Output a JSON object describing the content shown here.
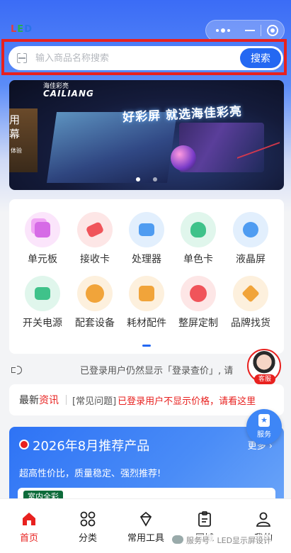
{
  "header": {
    "logo": [
      "L",
      "E",
      "D"
    ]
  },
  "search": {
    "placeholder": "输入商品名称搜索",
    "button_label": "搜索"
  },
  "banner": {
    "brand_cn": "海佳彩亮",
    "brand_en": "CAILIANG",
    "slogan": "好彩屏 就选海佳彩亮",
    "sign_text": "用幕",
    "sign_sub": "体验",
    "slides": 2,
    "active_slide": 0
  },
  "categories": [
    {
      "label": "单元板",
      "icon": "unit-board-icon",
      "bg": "#fbe5fb",
      "color": "#d66be6"
    },
    {
      "label": "接收卡",
      "icon": "receiver-card-icon",
      "bg": "#fde6e6",
      "color": "#f0545a"
    },
    {
      "label": "处理器",
      "icon": "processor-icon",
      "bg": "#e2effd",
      "color": "#4f9cf1"
    },
    {
      "label": "单色卡",
      "icon": "mono-card-icon",
      "bg": "#e0f6ec",
      "color": "#3fc28a"
    },
    {
      "label": "液晶屏",
      "icon": "lcd-screen-icon",
      "bg": "#e2effd",
      "color": "#4f9cf1"
    },
    {
      "label": "开关电源",
      "icon": "power-supply-icon",
      "bg": "#e0f6ec",
      "color": "#3fc28a"
    },
    {
      "label": "配套设备",
      "icon": "equipment-icon",
      "bg": "#fdf0dd",
      "color": "#f1a43a"
    },
    {
      "label": "耗材配件",
      "icon": "calendar-icon",
      "bg": "#fdf0dd",
      "color": "#f1a43a"
    },
    {
      "label": "整屏定制",
      "icon": "alarm-icon",
      "bg": "#fde6e6",
      "color": "#f0545a"
    },
    {
      "label": "品牌找货",
      "icon": "diamond-icon",
      "bg": "#fdf0dd",
      "color": "#f1a43a"
    }
  ],
  "notice": {
    "text": "已登录用户仍然显示「登录查价」, 请"
  },
  "news": {
    "label_a": "最新",
    "label_b": "资讯",
    "tag": "[常见问题]",
    "message": "已登录用户不显示价格，请看这里"
  },
  "recommend": {
    "title": "2026年8月推荐产品",
    "more": "更多",
    "subtitle": "超高性价比，质量稳定、强烈推荐!",
    "badge": "室内全彩"
  },
  "floating": {
    "customer_service": "客服",
    "service": "服务"
  },
  "tabbar": [
    {
      "label": "首页",
      "icon": "home-icon",
      "active": true
    },
    {
      "label": "分类",
      "icon": "category-icon",
      "active": false
    },
    {
      "label": "常用工具",
      "icon": "tools-icon",
      "active": false
    },
    {
      "label": "同城",
      "icon": "clipboard-icon",
      "active": false
    },
    {
      "label": "我的",
      "icon": "user-icon",
      "active": false
    }
  ],
  "watermark": "服务号 · LED显示屏设计"
}
